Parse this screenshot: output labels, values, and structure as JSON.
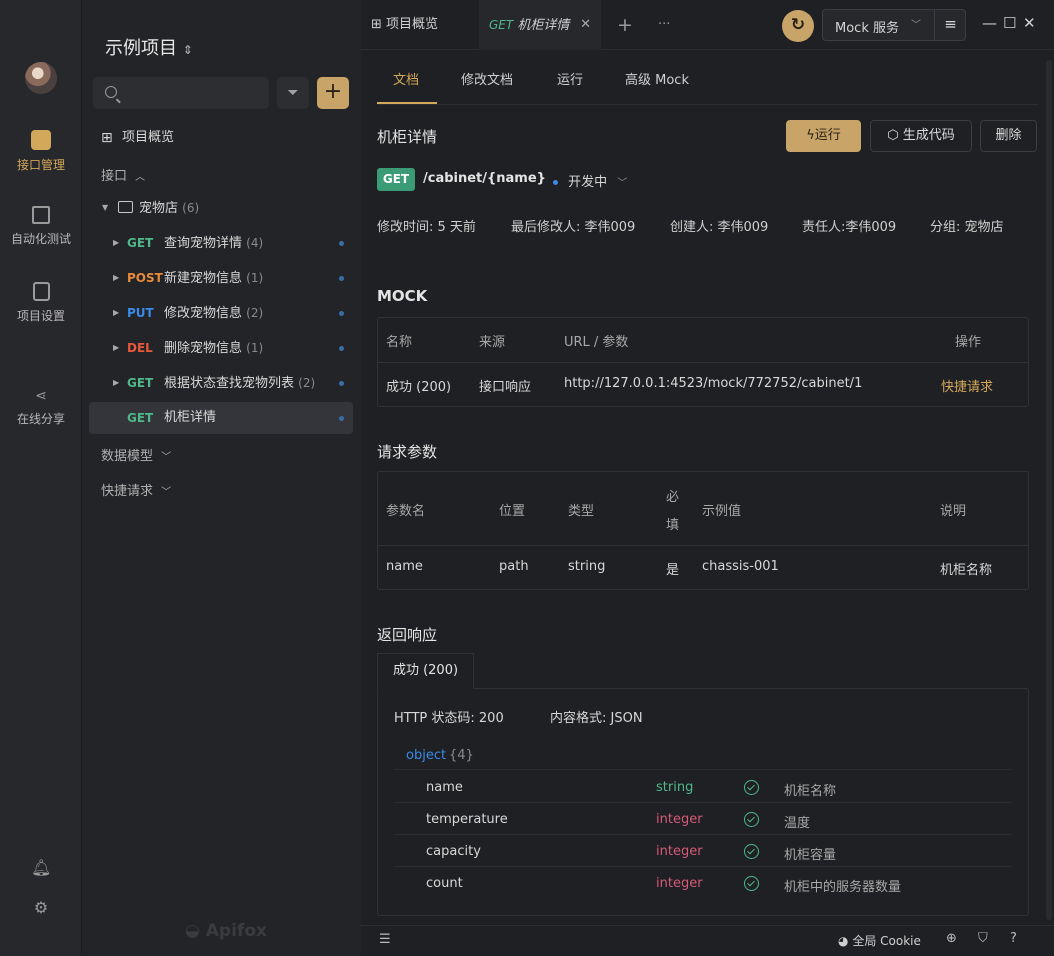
{
  "sidebar": {
    "project_title": "示例项目",
    "rail": [
      {
        "label": "接口管理"
      },
      {
        "label": "自动化测试"
      },
      {
        "label": "项目设置"
      },
      {
        "label": "在线分享"
      }
    ],
    "overview": "项目概览",
    "api_section": "接口",
    "folder": {
      "name": "宠物店",
      "count": "(6)"
    },
    "items": [
      {
        "method": "GET",
        "name": "查询宠物详情",
        "count": "(4)"
      },
      {
        "method": "POST",
        "name": "新建宠物信息",
        "count": "(1)"
      },
      {
        "method": "PUT",
        "name": "修改宠物信息",
        "count": "(2)"
      },
      {
        "method": "DEL",
        "name": "删除宠物信息",
        "count": "(1)"
      },
      {
        "method": "GET",
        "name": "根据状态查找宠物列表",
        "count": "(2)"
      },
      {
        "method": "GET",
        "name": "机柜详情",
        "count": ""
      }
    ],
    "data_models": "数据模型",
    "quick_requests": "快捷请求",
    "brand": "Apifox"
  },
  "topbar": {
    "tabs": [
      {
        "label": "项目概览"
      },
      {
        "method": "GET",
        "label": "机柜详情"
      }
    ],
    "mock_service": "Mock 服务"
  },
  "main": {
    "subtabs": [
      "文档",
      "修改文档",
      "运行",
      "高级 Mock"
    ],
    "title": "机柜详情",
    "buttons": {
      "run": "运行",
      "gen_code": "生成代码",
      "delete": "删除"
    },
    "method": "GET",
    "path": "/cabinet/{name}",
    "status": "开发中",
    "meta": {
      "modified": "修改时间: 5 天前",
      "last_editor": "最后修改人: 李伟009",
      "creator": "创建人: 李伟009",
      "owner": "责任人:李伟009",
      "group": "分组: 宠物店"
    },
    "mock": {
      "title": "MOCK",
      "headers": [
        "名称",
        "来源",
        "URL / 参数",
        "操作"
      ],
      "row": {
        "name": "成功 (200)",
        "source": "接口响应",
        "url": "http://127.0.0.1:4523/mock/772752/cabinet/1",
        "action": "快捷请求"
      }
    },
    "params": {
      "title": "请求参数",
      "headers": [
        "参数名",
        "位置",
        "类型",
        "必",
        "填",
        "示例值",
        "说明"
      ],
      "row": {
        "name": "name",
        "position": "path",
        "type": "string",
        "required": "是",
        "example": "chassis-001",
        "desc": "机柜名称"
      }
    },
    "response": {
      "title": "返回响应",
      "tab": "成功 (200)",
      "http_status": "HTTP 状态码: 200",
      "content_type": "内容格式: JSON",
      "object_label": "object",
      "object_count": "{4}",
      "fields": [
        {
          "name": "name",
          "type": "string",
          "desc": "机柜名称"
        },
        {
          "name": "temperature",
          "type": "integer",
          "desc": "温度"
        },
        {
          "name": "capacity",
          "type": "integer",
          "desc": "机柜容量"
        },
        {
          "name": "count",
          "type": "integer",
          "desc": "机柜中的服务器数量"
        }
      ]
    }
  },
  "bottombar": {
    "cookie": "全局 Cookie"
  },
  "colors": {
    "accent": "#c9a468",
    "get": "#4fb88a",
    "post": "#e88a3a",
    "put": "#3a8ae8",
    "del": "#e8583a",
    "integer": "#d45a78"
  }
}
